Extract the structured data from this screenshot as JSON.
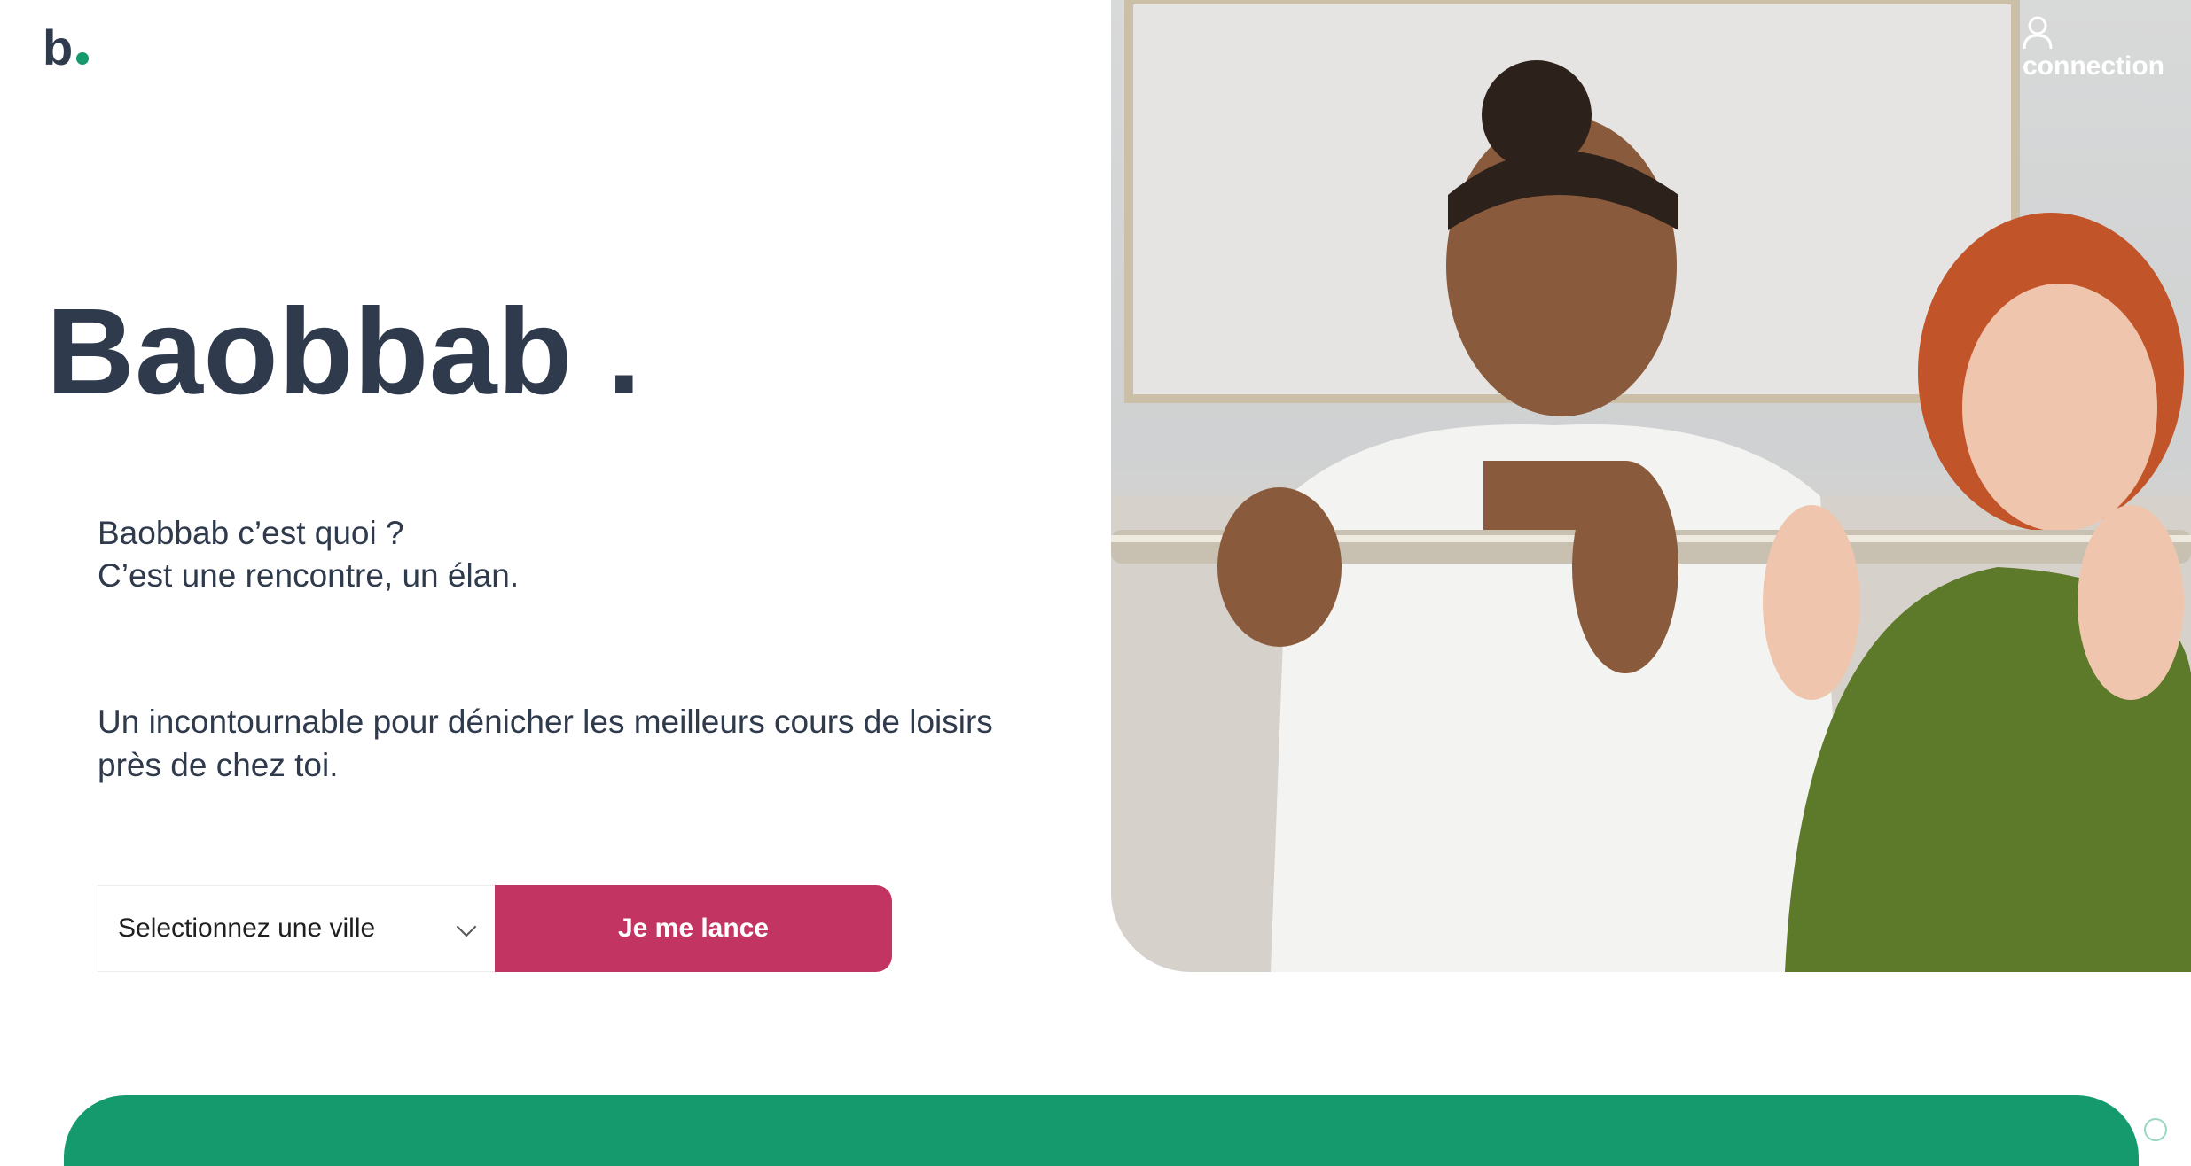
{
  "brand": {
    "logo_letter": "b",
    "accent_color": "#149a6c"
  },
  "header": {
    "connection_label": "connection",
    "connection_icon": "user-icon"
  },
  "hero": {
    "title": "Baobbab .",
    "intro_line1": "Baobbab c’est quoi ?",
    "intro_line2": "C’est une rencontre, un élan.",
    "pitch": "Un incontournable pour dénicher les meilleurs cours de loisirs près de chez toi."
  },
  "search": {
    "city_placeholder": "Selectionnez une ville",
    "cta_label": "Je me lance",
    "cta_color": "#c23461"
  },
  "colors": {
    "text": "#2f3a4c",
    "band": "#149a6c"
  }
}
